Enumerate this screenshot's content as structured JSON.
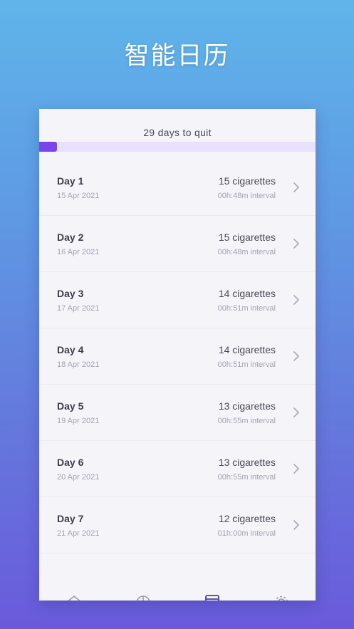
{
  "headline": "智能日历",
  "quit_label": "29 days to quit",
  "progress": {
    "fraction": 0.065,
    "fill_color": "#7b45ec",
    "track_color": "#e9e0fb"
  },
  "days": [
    {
      "title": "Day 1",
      "date": "15 Apr 2021",
      "cigarettes": "15 cigarettes",
      "interval": "00h:48m interval"
    },
    {
      "title": "Day 2",
      "date": "16 Apr 2021",
      "cigarettes": "15 cigarettes",
      "interval": "00h:48m interval"
    },
    {
      "title": "Day 3",
      "date": "17 Apr 2021",
      "cigarettes": "14 cigarettes",
      "interval": "00h:51m interval"
    },
    {
      "title": "Day 4",
      "date": "18 Apr 2021",
      "cigarettes": "14 cigarettes",
      "interval": "00h:51m interval"
    },
    {
      "title": "Day 5",
      "date": "19 Apr 2021",
      "cigarettes": "13 cigarettes",
      "interval": "00h:55m interval"
    },
    {
      "title": "Day 6",
      "date": "20 Apr 2021",
      "cigarettes": "13 cigarettes",
      "interval": "00h:55m interval"
    },
    {
      "title": "Day 7",
      "date": "21 Apr 2021",
      "cigarettes": "12 cigarettes",
      "interval": "01h:00m interval"
    }
  ],
  "tabs": [
    {
      "icon": "home-icon",
      "active": false
    },
    {
      "icon": "pie-chart-icon",
      "active": false
    },
    {
      "icon": "calendar-icon",
      "active": true
    },
    {
      "icon": "gear-icon",
      "active": false
    }
  ],
  "colors": {
    "accent": "#7b45ec",
    "active_tab": "#4b3f8f",
    "inactive_tab": "#9a9aaa"
  }
}
